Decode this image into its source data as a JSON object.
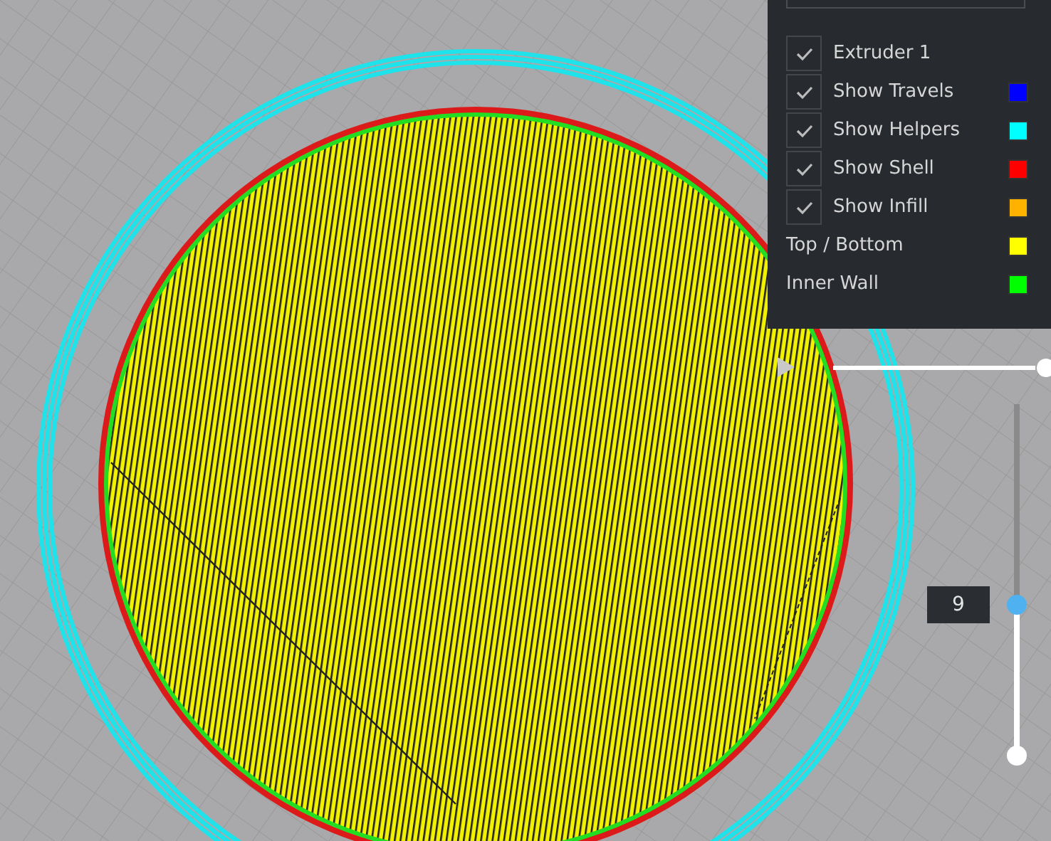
{
  "legend": {
    "items": [
      {
        "kind": "check",
        "label": "Extruder 1",
        "checked": true
      },
      {
        "kind": "check",
        "label": "Show Travels",
        "checked": true,
        "color": "#0000ff"
      },
      {
        "kind": "check",
        "label": "Show Helpers",
        "checked": true,
        "color": "#00ffff"
      },
      {
        "kind": "check",
        "label": "Show Shell",
        "checked": true,
        "color": "#ff0000"
      },
      {
        "kind": "check",
        "label": "Show Infill",
        "checked": true,
        "color": "#ffb300"
      },
      {
        "kind": "swatch",
        "label": "Top / Bottom",
        "color": "#ffff00"
      },
      {
        "kind": "swatch",
        "label": "Inner Wall",
        "color": "#00ff00"
      }
    ]
  },
  "path_slider": {
    "level": 1
  },
  "layer_slider": {
    "value": "9",
    "level": 0.43
  }
}
